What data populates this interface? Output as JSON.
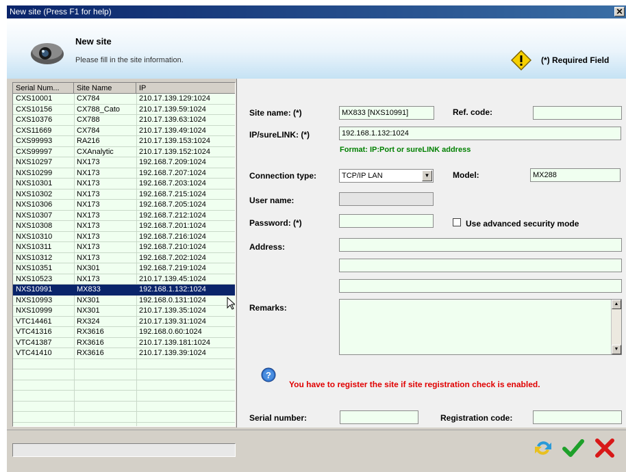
{
  "window": {
    "title": "New site (Press F1 for help)",
    "close_glyph": "✕"
  },
  "header": {
    "title": "New site",
    "subtitle": "Please fill in the site information.",
    "required_text": "(*) Required Field",
    "icon": "camera-icon",
    "warning_icon": "warning-diamond-icon"
  },
  "table": {
    "columns": [
      "Serial Num...",
      "Site Name",
      "IP"
    ],
    "rows": [
      [
        "CXS10001",
        "CX784",
        "210.17.139.129:1024"
      ],
      [
        "CXS10156",
        "CX788_Cato",
        "210.17.139.59:1024"
      ],
      [
        "CXS10376",
        "CX788",
        "210.17.139.63:1024"
      ],
      [
        "CXS11669",
        "CX784",
        "210.17.139.49:1024"
      ],
      [
        "CXS99993",
        "RA216",
        "210.17.139.153:1024"
      ],
      [
        "CXS99997",
        "CXAnalytic",
        "210.17.139.152:1024"
      ],
      [
        "NXS10297",
        "NX173",
        "192.168.7.209:1024"
      ],
      [
        "NXS10299",
        "NX173",
        "192.168.7.207:1024"
      ],
      [
        "NXS10301",
        "NX173",
        "192.168.7.203:1024"
      ],
      [
        "NXS10302",
        "NX173",
        "192.168.7.215:1024"
      ],
      [
        "NXS10306",
        "NX173",
        "192.168.7.205:1024"
      ],
      [
        "NXS10307",
        "NX173",
        "192.168.7.212:1024"
      ],
      [
        "NXS10308",
        "NX173",
        "192.168.7.201:1024"
      ],
      [
        "NXS10310",
        "NX173",
        "192.168.7.216:1024"
      ],
      [
        "NXS10311",
        "NX173",
        "192.168.7.210:1024"
      ],
      [
        "NXS10312",
        "NX173",
        "192.168.7.202:1024"
      ],
      [
        "NXS10351",
        "NX301",
        "192.168.7.219:1024"
      ],
      [
        "NXS10523",
        "NX173",
        "210.17.139.45:1024"
      ],
      [
        "NXS10991",
        "MX833",
        "192.168.1.132:1024"
      ],
      [
        "NXS10993",
        "NX301",
        "192.168.0.131:1024"
      ],
      [
        "NXS10999",
        "NX301",
        "210.17.139.35:1024"
      ],
      [
        "VTC14461",
        "RX324",
        "210.17.139.31:1024"
      ],
      [
        "VTC41316",
        "RX3616",
        "192.168.0.60:1024"
      ],
      [
        "VTC41387",
        "RX3616",
        "210.17.139.181:1024"
      ],
      [
        "VTC41410",
        "RX3616",
        "210.17.139.39:1024"
      ]
    ],
    "selected_index": 18
  },
  "form": {
    "site_name_label": "Site name: (*)",
    "site_name_value": "MX833 [NXS10991]",
    "ref_code_label": "Ref. code:",
    "ref_code_value": "",
    "ip_label": "IP/sureLINK: (*)",
    "ip_value": "192.168.1.132:1024",
    "ip_hint": "Format: IP:Port or sureLINK address",
    "conn_type_label": "Connection type:",
    "conn_type_value": "TCP/IP LAN",
    "model_label": "Model:",
    "model_value": "MX288",
    "username_label": "User name:",
    "username_value": "",
    "password_label": "Password: (*)",
    "password_value": "",
    "adv_security_label": "Use advanced security mode",
    "adv_security_checked": false,
    "address_label": "Address:",
    "address_lines": [
      "",
      "",
      ""
    ],
    "remarks_label": "Remarks:",
    "remarks_value": "",
    "info_text": "You have to register the site if site registration check is enabled.",
    "serial_label": "Serial number:",
    "serial_value": "",
    "regcode_label": "Registration code:",
    "regcode_value": ""
  },
  "buttons": [
    "refresh-icon",
    "ok-check-icon",
    "cancel-x-icon"
  ],
  "colors": {
    "title_bar": "#0a246a",
    "selection": "#0a246a",
    "hint_green": "#008000",
    "warning_red": "#e00000",
    "field_bg": "#f0fff0"
  }
}
